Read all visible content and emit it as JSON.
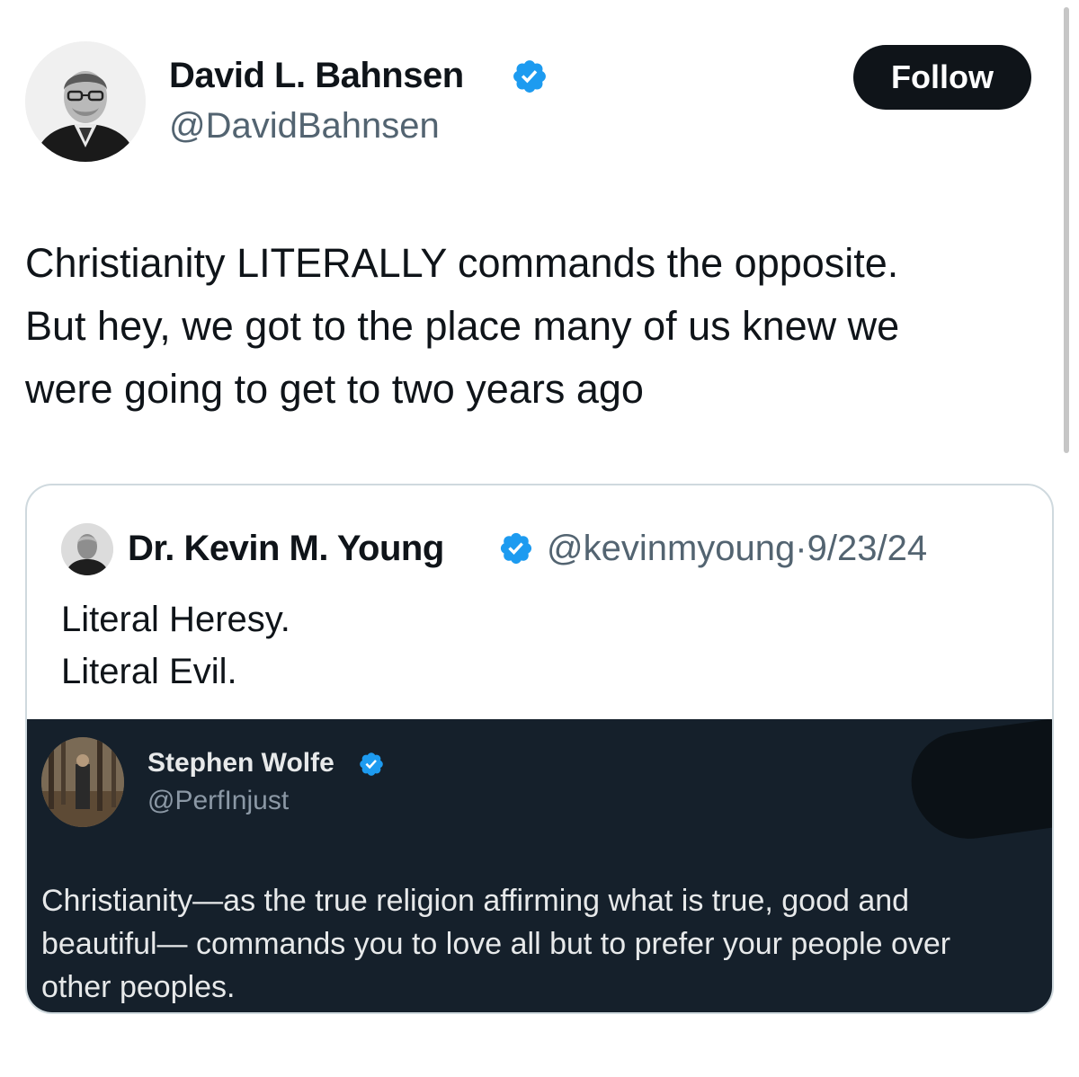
{
  "tweet": {
    "author": {
      "name": "David L. Bahnsen",
      "handle": "@DavidBahnsen",
      "avatar_icon": "person-portrait-avatar",
      "verified": true
    },
    "follow_label": "Follow",
    "text_lines": [
      "Christianity LITERALLY commands the opposite.",
      "But hey, we got to the place many of us knew we",
      "were going to get to two years ago"
    ]
  },
  "quote": {
    "author": {
      "name": "Dr. Kevin M. Young",
      "handle_date": "@kevinmyoung·9/23/24",
      "avatar_icon": "person-portrait-avatar",
      "verified": true
    },
    "text_lines": [
      "Literal Heresy.",
      "Literal Evil."
    ],
    "embedded_screenshot": {
      "author": {
        "name": "Stephen Wolfe",
        "handle": "@PerfInjust",
        "avatar_icon": "forest-portrait-avatar",
        "verified": true
      },
      "text_lines": [
        "Christianity—as the true religion affirming what is true, good and",
        "beautiful— commands you to love all but to prefer your people over",
        "other peoples."
      ]
    }
  },
  "colors": {
    "verified_blue": "#1d9bf0",
    "follow_bg": "#0f1419",
    "dark_bg": "#15202b",
    "secondary_text": "#536471"
  }
}
